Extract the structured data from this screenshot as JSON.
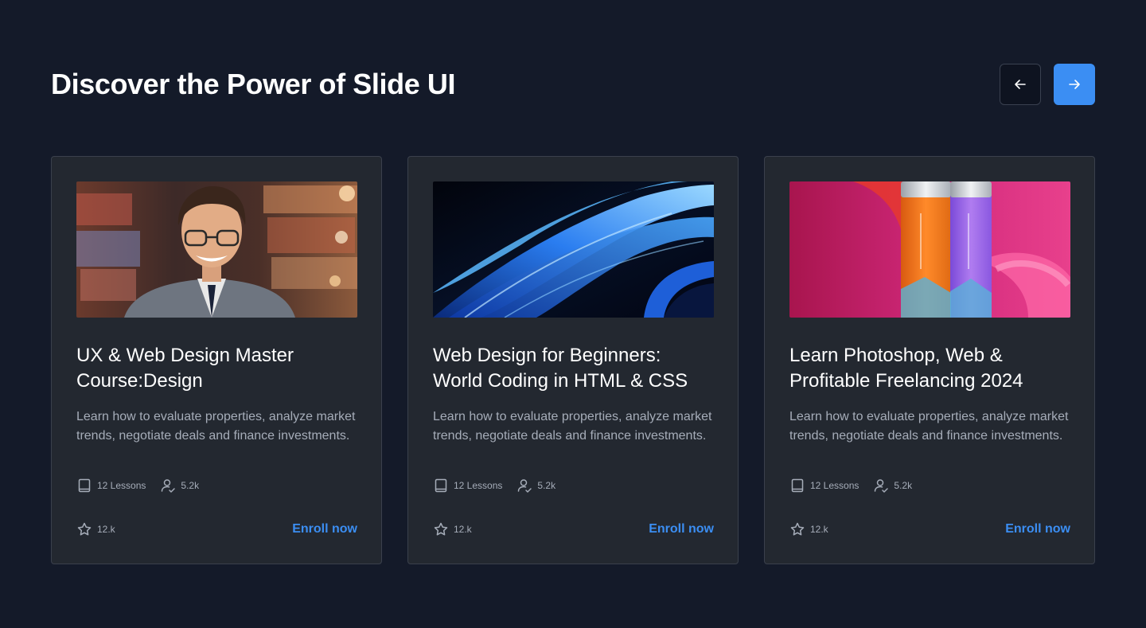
{
  "header": {
    "title": "Discover the Power of Slide UI",
    "prev_icon": "arrow-left-icon",
    "next_icon": "arrow-right-icon"
  },
  "colors": {
    "background": "#141a29",
    "card": "#232830",
    "accent": "#3b8ef3",
    "muted_text": "#a6adb9"
  },
  "cards": [
    {
      "image": "portrait of smiling man with glasses in suit",
      "title": "UX & Web Design Master Course:Design",
      "description": "Learn how to evaluate properties, analyze market trends, negotiate deals and finance investments.",
      "lessons": "12 Lessons",
      "students": "5.2k",
      "rating": "12.k",
      "cta": "Enroll now"
    },
    {
      "image": "abstract blue flowing waves",
      "title": "Web Design for Beginners: World Coding in HTML & CSS",
      "description": "Learn how to evaluate properties, analyze market trends, negotiate deals and finance investments.",
      "lessons": "12 Lessons",
      "students": "5.2k",
      "rating": "12.k",
      "cta": "Enroll now"
    },
    {
      "image": "orange and purple cans on pink background",
      "title": "Learn Photoshop, Web & Profitable Freelancing 2024",
      "description": "Learn how to evaluate properties, analyze market trends, negotiate deals and finance investments.",
      "lessons": "12 Lessons",
      "students": "5.2k",
      "rating": "12.k",
      "cta": "Enroll now"
    }
  ]
}
